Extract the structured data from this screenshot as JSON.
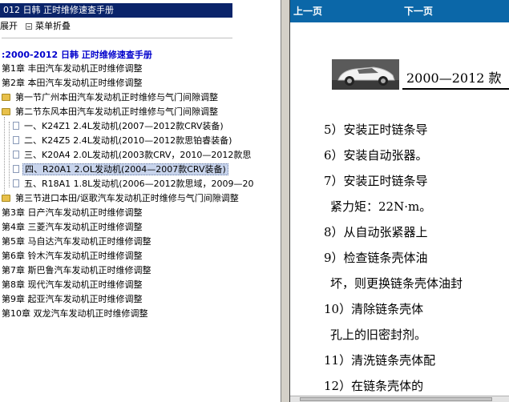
{
  "left": {
    "title": "012 日韩 正时维修速查手册",
    "toolbar": {
      "expand": "展开",
      "collapse": "菜单折叠"
    },
    "book_title": ":2000-2012 日韩 正时维修速查手册",
    "tree": [
      {
        "label": "第1章 丰田汽车发动机正时维修调整",
        "icon": "none"
      },
      {
        "label": "第2章 本田汽车发动机正时维修调整",
        "icon": "none"
      },
      {
        "label": "第一节广州本田汽车发动机正时维修与气门间隙调整",
        "icon": "folder-icon"
      },
      {
        "label": "第二节东风本田汽车发动机正时维修与气门间隙调整",
        "icon": "folder-icon"
      },
      {
        "label": "一、K24Z1 2.4L发动机(2007—2012款CRV装备)",
        "icon": "doc-icon"
      },
      {
        "label": "二、K24Z5 2.4L发动机(2010—2012款思铂睿装备)",
        "icon": "doc-icon"
      },
      {
        "label": "三、K20A4 2.0L发动机(2003款CRV，2010—2012款思",
        "icon": "doc-icon"
      },
      {
        "label": "四、R20A1 2.OL发动机(2004—2007款CRV装备)",
        "icon": "doc-icon",
        "selected": true
      },
      {
        "label": "五、R18A1 1.8L发动机(2006—2012款思域，2009—20",
        "icon": "doc-icon"
      },
      {
        "label": "第三节进口本田/讴歌汽车发动机正时维修与气门间隙调整",
        "icon": "folder-icon"
      },
      {
        "label": "第3章 日产汽车发动机正时维修调整",
        "icon": "none"
      },
      {
        "label": "第4章 三菱汽车发动机正时维修调整",
        "icon": "none"
      },
      {
        "label": "第5章 马自达汽车发动机正时维修调整",
        "icon": "none"
      },
      {
        "label": "第6章 铃木汽车发动机正时维修调整",
        "icon": "none"
      },
      {
        "label": "第7章 斯巴鲁汽车发动机正时维修调整",
        "icon": "none"
      },
      {
        "label": "第8章 现代汽车发动机正时维修调整",
        "icon": "none"
      },
      {
        "label": "第9章 起亚汽车发动机正时维修调整",
        "icon": "none"
      },
      {
        "label": "第10章 双龙汽车发动机正时维修调整",
        "icon": "none"
      }
    ]
  },
  "right": {
    "prev": "上一页",
    "next": "下一页",
    "header": "2000—2012 款",
    "paragraphs": [
      "5）安装正时链条导",
      "6）安装自动张器。",
      "7）安装正时链条导",
      "紧力矩：22N·m。",
      "8）从自动张紧器上",
      "9）检查链条壳体油",
      "坏，则更换链条壳体油封",
      "10）清除链条壳体",
      "孔上的旧密封剂。",
      "11）清洗链条壳体配",
      "12）在链条壳体的"
    ]
  },
  "colors": {
    "title_bar": "#0a246a",
    "nav_bar": "#0b67a8",
    "book_title": "#0000cc",
    "selection": "#c8d4ec"
  }
}
